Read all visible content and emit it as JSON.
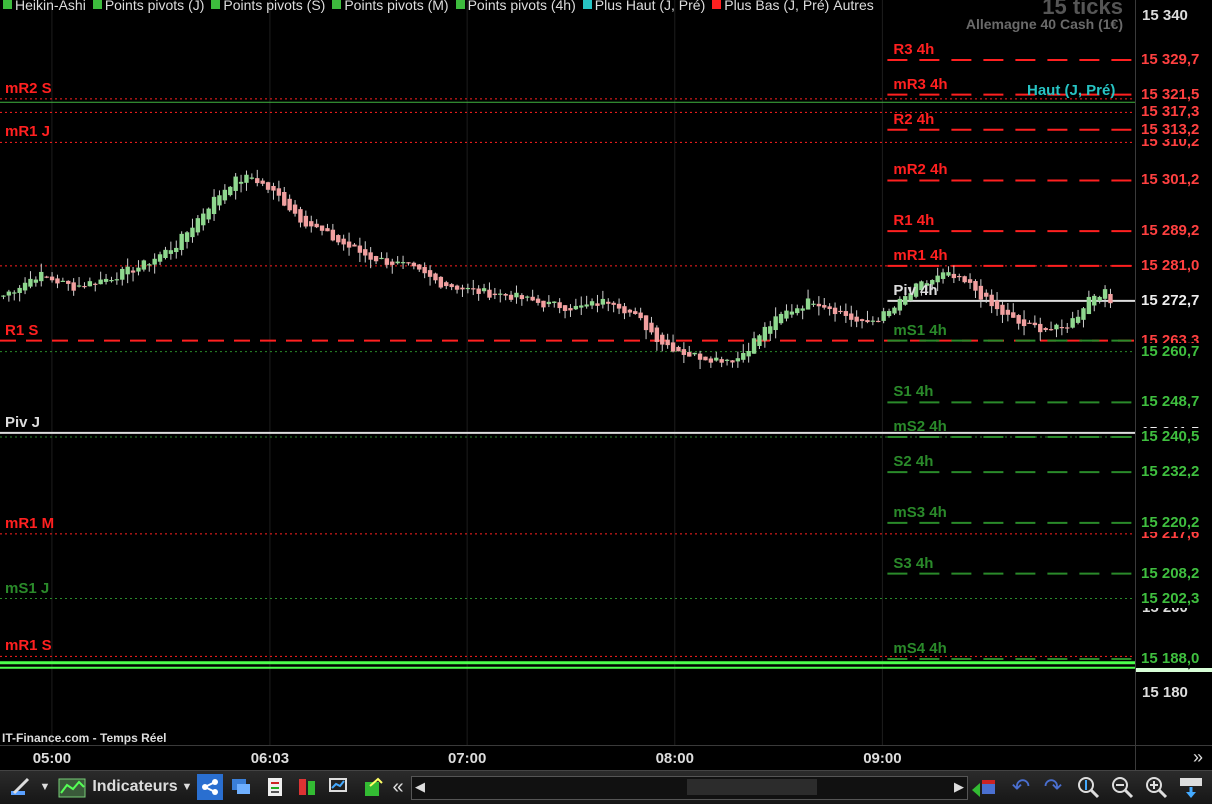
{
  "header": {
    "legend": [
      {
        "label": "Heikin-Ashi",
        "color": "#3dbb3d"
      },
      {
        "label": "Points pivots (J)",
        "color": "#3dbb3d"
      },
      {
        "label": "Points pivots (S)",
        "color": "#3dbb3d"
      },
      {
        "label": "Points pivots (M)",
        "color": "#3dbb3d"
      },
      {
        "label": "Points pivots (4h)",
        "color": "#3dbb3d"
      },
      {
        "label": "Plus Haut (J, Pré)",
        "color": "#27c4c4"
      },
      {
        "label": "Plus Bas (J, Pré)",
        "color": "#ff2020"
      },
      {
        "label": "Autres",
        "color": ""
      }
    ],
    "ticks_label": "15 ticks",
    "instrument": "Allemagne 40 Cash (1€)"
  },
  "source_label": "IT-Finance.com - Temps Réel",
  "toolbar": {
    "indicators_label": "Indicateurs",
    "scroll_left": "«",
    "expand": "»"
  },
  "colors": {
    "up": "#8fd88f",
    "down": "#f2a0a0",
    "resistance": "#ff2020",
    "support": "#2a8a2a",
    "pivot": "#dddddd",
    "high": "#27c4c4",
    "low": "#4cff4c"
  },
  "chart_data": {
    "type": "candlestick",
    "instrument": "Allemagne 40 Cash (1€)",
    "candle_style": "Heikin-Ashi",
    "ylim": [
      15179,
      15342
    ],
    "xlim": [
      "04:45",
      "10:13"
    ],
    "x_ticks": [
      "05:00",
      "06:03",
      "07:00",
      "08:00",
      "09:00"
    ],
    "y_ticks": [
      15340,
      15180
    ],
    "last_price": 15272.7,
    "candles_close": [
      {
        "t": "04:46",
        "c": 15274
      },
      {
        "t": "04:56",
        "c": 15279
      },
      {
        "t": "05:06",
        "c": 15276
      },
      {
        "t": "05:16",
        "c": 15278
      },
      {
        "t": "05:26",
        "c": 15281
      },
      {
        "t": "05:36",
        "c": 15286
      },
      {
        "t": "05:46",
        "c": 15296
      },
      {
        "t": "05:52",
        "c": 15301
      },
      {
        "t": "05:58",
        "c": 15302
      },
      {
        "t": "06:06",
        "c": 15297
      },
      {
        "t": "06:12",
        "c": 15292
      },
      {
        "t": "06:22",
        "c": 15287
      },
      {
        "t": "06:32",
        "c": 15283
      },
      {
        "t": "06:42",
        "c": 15281
      },
      {
        "t": "06:52",
        "c": 15277
      },
      {
        "t": "07:02",
        "c": 15275
      },
      {
        "t": "07:12",
        "c": 15274
      },
      {
        "t": "07:22",
        "c": 15272
      },
      {
        "t": "07:32",
        "c": 15271
      },
      {
        "t": "07:42",
        "c": 15273
      },
      {
        "t": "07:50",
        "c": 15268
      },
      {
        "t": "07:56",
        "c": 15263
      },
      {
        "t": "08:04",
        "c": 15260
      },
      {
        "t": "08:12",
        "c": 15259
      },
      {
        "t": "08:18",
        "c": 15259
      },
      {
        "t": "08:26",
        "c": 15266
      },
      {
        "t": "08:32",
        "c": 15270
      },
      {
        "t": "08:40",
        "c": 15273
      },
      {
        "t": "08:48",
        "c": 15270
      },
      {
        "t": "08:54",
        "c": 15267
      },
      {
        "t": "09:02",
        "c": 15270
      },
      {
        "t": "09:10",
        "c": 15276
      },
      {
        "t": "09:18",
        "c": 15279
      },
      {
        "t": "09:26",
        "c": 15276
      },
      {
        "t": "09:32",
        "c": 15271
      },
      {
        "t": "09:40",
        "c": 15267
      },
      {
        "t": "09:48",
        "c": 15266
      },
      {
        "t": "09:52",
        "c": 15266
      },
      {
        "t": "09:56",
        "c": 15269
      },
      {
        "t": "10:00",
        "c": 15274
      },
      {
        "t": "10:04",
        "c": 15275
      },
      {
        "t": "10:06",
        "c": 15272
      }
    ],
    "levels_left": [
      {
        "label": "mR2 S",
        "price": 15320.5,
        "price_label": "",
        "kind": "res",
        "style": "dotted"
      },
      {
        "label": "",
        "price": 15317.3,
        "price_label": "15 317,3",
        "kind": "res",
        "style": "dotted"
      },
      {
        "label": "mR1 J",
        "price": 15310.2,
        "price_label": "15 310,2",
        "kind": "res",
        "style": "dotted"
      },
      {
        "label": "",
        "price": 15281.0,
        "price_label": "15 281,0",
        "kind": "res",
        "style": "dotted"
      },
      {
        "label": "R1 S",
        "price": 15263.3,
        "price_label": "15 263,3",
        "kind": "res",
        "style": "dashed"
      },
      {
        "label": "",
        "price": 15260.7,
        "price_label": "15 260,7",
        "kind": "sup",
        "style": "dotted"
      },
      {
        "label": "Piv J",
        "price": 15241.5,
        "price_label": "15 241,5",
        "kind": "pivot",
        "style": "solid"
      },
      {
        "label": "",
        "price": 15240.5,
        "price_label": "15 240,5",
        "kind": "sup",
        "style": "dotted"
      },
      {
        "label": "mR1 M",
        "price": 15217.6,
        "price_label": "15 217,6",
        "kind": "res",
        "style": "dotted"
      },
      {
        "label": "mS1 J",
        "price": 15202.3,
        "price_label": "15 202,3",
        "kind": "sup",
        "style": "dotted"
      },
      {
        "label": "mR1 S",
        "price": 15188.6,
        "price_label": "15 188,6",
        "kind": "res",
        "style": "dotted"
      }
    ],
    "levels_4h": [
      {
        "label": "R3 4h",
        "price": 15329.7,
        "price_label": "15 329,7",
        "kind": "res"
      },
      {
        "label": "mR3 4h",
        "price": 15321.5,
        "price_label": "15 321,5",
        "kind": "res"
      },
      {
        "label": "R2 4h",
        "price": 15313.2,
        "price_label": "15 313,2",
        "kind": "res"
      },
      {
        "label": "mR2 4h",
        "price": 15301.2,
        "price_label": "15 301,2",
        "kind": "res"
      },
      {
        "label": "R1 4h",
        "price": 15289.2,
        "price_label": "15 289,2",
        "kind": "res"
      },
      {
        "label": "mR1 4h",
        "price": 15281.0,
        "price_label": "",
        "kind": "res"
      },
      {
        "label": "Piv 4h",
        "price": 15272.7,
        "price_label": "",
        "kind": "pivot"
      },
      {
        "label": "mS1 4h",
        "price": 15263.3,
        "price_label": "",
        "kind": "sup"
      },
      {
        "label": "S1 4h",
        "price": 15248.7,
        "price_label": "15 248,7",
        "kind": "sup"
      },
      {
        "label": "mS2 4h",
        "price": 15240.5,
        "price_label": "",
        "kind": "sup"
      },
      {
        "label": "S2 4h",
        "price": 15232.2,
        "price_label": "15 232,2",
        "kind": "sup"
      },
      {
        "label": "mS3 4h",
        "price": 15220.2,
        "price_label": "15 220,2",
        "kind": "sup"
      },
      {
        "label": "S3 4h",
        "price": 15208.2,
        "price_label": "15 208,2",
        "kind": "sup"
      },
      {
        "label": "mS4 4h",
        "price": 15188.0,
        "price_label": "15 188,0",
        "kind": "sup"
      }
    ],
    "high_prev_day": {
      "label": "Haut (J, Pré)",
      "price": 15319.7,
      "price_label": "15 319,7"
    },
    "low_prev_day": {
      "price": 15187.1,
      "price_label": "15 187,1"
    },
    "hidden_tick": "15 200"
  }
}
